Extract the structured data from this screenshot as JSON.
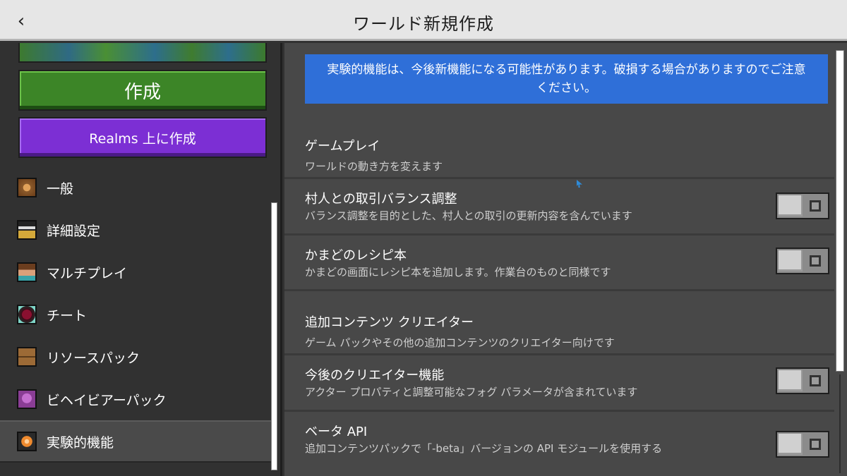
{
  "header": {
    "title": "ワールド新規作成",
    "back_icon": "chevron-left-icon"
  },
  "sidebar": {
    "create_label": "作成",
    "realms_label": "Realms 上に作成",
    "items": [
      {
        "label": "一般",
        "icon": "general-icon"
      },
      {
        "label": "詳細設定",
        "icon": "advanced-settings-icon"
      },
      {
        "label": "マルチプレイ",
        "icon": "multiplayer-icon"
      },
      {
        "label": "チート",
        "icon": "cheat-icon"
      },
      {
        "label": "リソースパック",
        "icon": "resource-pack-icon"
      },
      {
        "label": "ビヘイビアーパック",
        "icon": "behavior-pack-icon"
      },
      {
        "label": "実験的機能",
        "icon": "experiment-icon",
        "active": true
      }
    ]
  },
  "main": {
    "notice": "実験的機能は、今後新機能になる可能性があります。破損する場合がありますのでご注意ください。",
    "sections": [
      {
        "title": "ゲームプレイ",
        "desc": "ワールドの動き方を変えます",
        "rows": [
          {
            "title": "村人との取引バランス調整",
            "desc": "バランス調整を目的とした、村人との取引の更新内容を含んでいます",
            "enabled": false
          },
          {
            "title": "かまどのレシピ本",
            "desc": "かまどの画面にレシピ本を追加します。作業台のものと同様です",
            "enabled": false
          }
        ]
      },
      {
        "title": "追加コンテンツ クリエイター",
        "desc": "ゲーム パックやその他の追加コンテンツのクリエイター向けです",
        "rows": [
          {
            "title": "今後のクリエイター機能",
            "desc": "アクター プロパティと調整可能なフォグ パラメータが含まれています",
            "enabled": false
          },
          {
            "title": "ベータ API",
            "desc": "追加コンテンツパックで「-beta」バージョンの API モジュールを使用する",
            "enabled": false
          }
        ]
      }
    ]
  },
  "colors": {
    "notice_bg": "#2f6fd8",
    "create_button": "#3c8527",
    "realms_button": "#7c2fd4"
  }
}
